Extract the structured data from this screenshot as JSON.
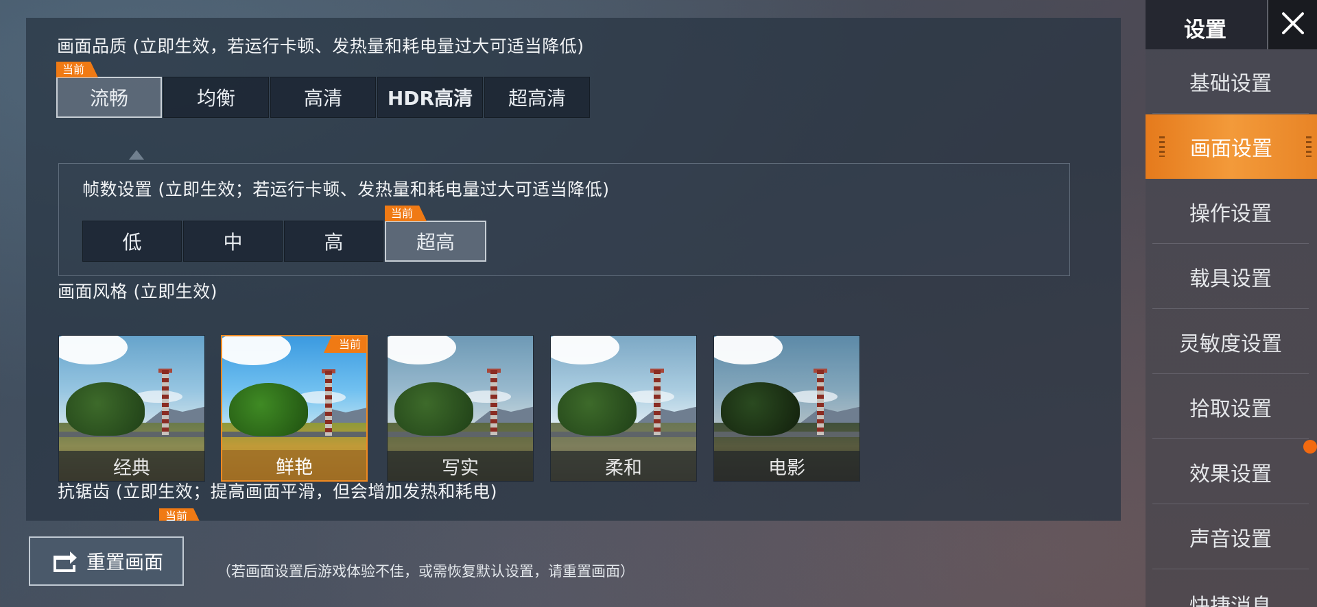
{
  "quality": {
    "title": "画面品质 (立即生效，若运行卡顿、发热量和耗电量过大可适当降低)",
    "current_tag": "当前",
    "options": [
      "流畅",
      "均衡",
      "高清",
      "HDR高清",
      "超高清"
    ],
    "selected": "流畅"
  },
  "fps": {
    "title": "帧数设置 (立即生效；若运行卡顿、发热量和耗电量过大可适当降低)",
    "current_tag": "当前",
    "options": [
      "低",
      "中",
      "高",
      "超高"
    ],
    "selected": "超高"
  },
  "style": {
    "title": "画面风格 (立即生效)",
    "current_tag": "当前",
    "options": [
      "经典",
      "鲜艳",
      "写实",
      "柔和",
      "电影"
    ],
    "selected": "鲜艳"
  },
  "antialias": {
    "title": "抗锯齿 (立即生效；提高画面平滑，但会增加发热和耗电)",
    "current_tag": "当前"
  },
  "reset": {
    "label": "重置画面",
    "hint": "（若画面设置后游戏体验不佳，或需恢复默认设置，请重置画面）"
  },
  "sidebar": {
    "title": "设置",
    "items": [
      {
        "label": "基础设置"
      },
      {
        "label": "画面设置"
      },
      {
        "label": "操作设置"
      },
      {
        "label": "载具设置"
      },
      {
        "label": "灵敏度设置"
      },
      {
        "label": "拾取设置"
      },
      {
        "label": "效果设置"
      },
      {
        "label": "声音设置"
      },
      {
        "label": "快捷消息"
      }
    ],
    "active": "画面设置"
  },
  "colors": {
    "accent": "#f07a14",
    "notify_dot": "#f26a10"
  }
}
